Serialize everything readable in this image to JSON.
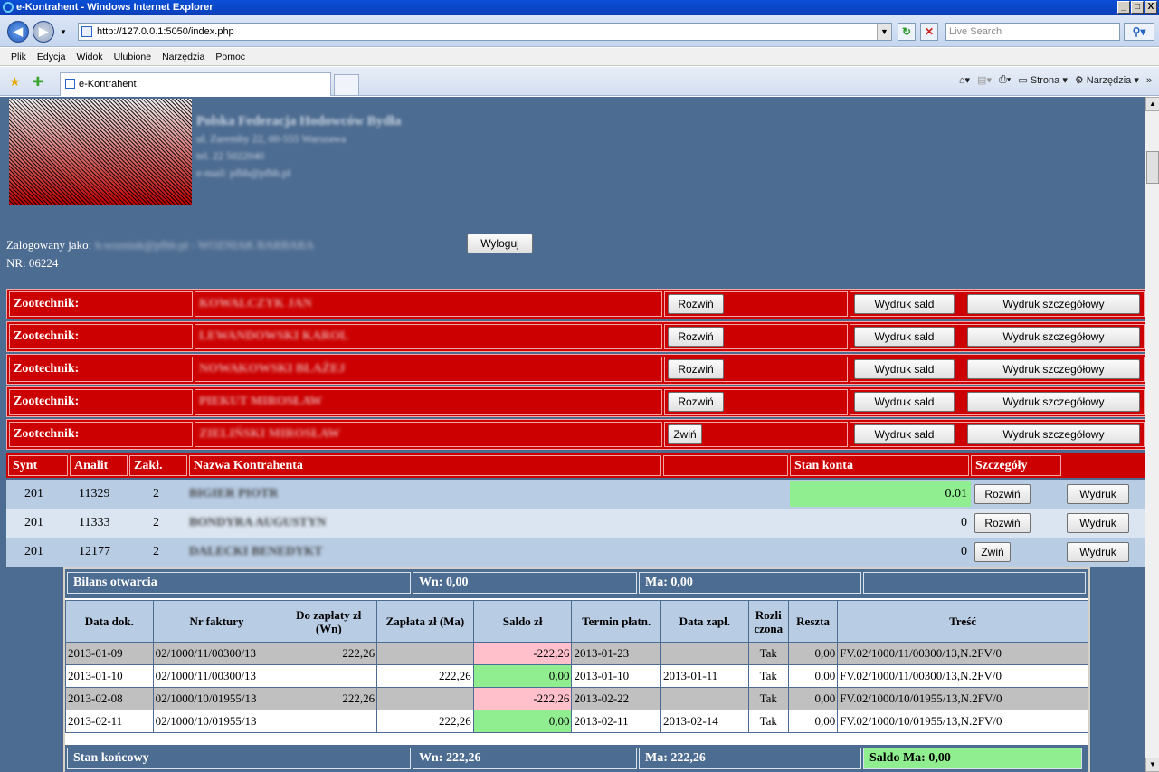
{
  "window": {
    "title": "e-Kontrahent - Windows Internet Explorer",
    "controls": [
      "_",
      "□",
      "X"
    ]
  },
  "address": {
    "url": "http://127.0.0.1:5050/index.php",
    "search_placeholder": "Live Search"
  },
  "menu": [
    "Plik",
    "Edycja",
    "Widok",
    "Ulubione",
    "Narzędzia",
    "Pomoc"
  ],
  "tab": {
    "label": "e-Kontrahent"
  },
  "commandbar": {
    "page": "Strona",
    "tools": "Narzędzia"
  },
  "header": {
    "org_name": "Polska Federacja Hodowców Bydła",
    "org_addr": "ul. Zaremby 22, 00-555 Warszawa",
    "org_tel": "tel. 22 5022040",
    "org_mail": "e-mail: pfhb@pfhb.pl",
    "logged_label": "Zalogowany jako:",
    "logged_user": "b.wozniak@pfhb.pl - WOZNIAK BARBARA",
    "logout": "Wyloguj",
    "nr": "NR: 06224"
  },
  "zoo": {
    "label": "Zootechnik:",
    "expand": "Rozwiń",
    "collapse": "Zwiń",
    "print_saldo": "Wydruk sald",
    "print_detail": "Wydruk szczegółowy",
    "rows": [
      {
        "name": "KOWALCZYK JAN",
        "btn": "Rozwiń"
      },
      {
        "name": "LEWANDOWSKI KAROL",
        "btn": "Rozwiń"
      },
      {
        "name": "NOWAKOWSKI BLAŻEJ",
        "btn": "Rozwiń"
      },
      {
        "name": "PIEKUT MIROSŁAW",
        "btn": "Rozwiń"
      },
      {
        "name": "ZIELIŃSKI MIROSŁAW",
        "btn": "Zwiń"
      }
    ]
  },
  "contractors": {
    "headers": {
      "synt": "Synt",
      "analit": "Analit",
      "zakl": "Zakł.",
      "name": "Nazwa Kontrahenta",
      "empty": "",
      "stan": "Stan konta",
      "det": "Szczegóły"
    },
    "print": "Wydruk",
    "rows": [
      {
        "synt": "201",
        "analit": "11329",
        "zakl": "2",
        "name": "BIGIER PIOTR",
        "stan": "0.01",
        "btn": "Rozwiń"
      },
      {
        "synt": "201",
        "analit": "11333",
        "zakl": "2",
        "name": "BONDYRA AUGUSTYN",
        "stan": "0",
        "btn": "Rozwiń"
      },
      {
        "synt": "201",
        "analit": "12177",
        "zakl": "2",
        "name": "DALECKI BENEDYKT",
        "stan": "0",
        "btn": "Zwiń"
      }
    ]
  },
  "details": {
    "open": {
      "label": "Bilans otwarcia",
      "wn": "Wn: 0,00",
      "ma": "Ma: 0,00",
      "saldo": ""
    },
    "close": {
      "label": "Stan końcowy",
      "wn": "Wn: 222,26",
      "ma": "Ma: 222,26",
      "saldo": "Saldo Ma: 0,00"
    },
    "columns": [
      "Data dok.",
      "Nr faktury",
      "Do zapłaty zł (Wn)",
      "Zapłata zł (Ma)",
      "Saldo zł",
      "Termin płatn.",
      "Data zapł.",
      "Rozli czona",
      "Reszta",
      "Treść"
    ],
    "rows": [
      [
        "2013-01-09",
        "02/1000/11/00300/13",
        "222,26",
        "",
        "-222,26",
        "2013-01-23",
        "",
        "Tak",
        "0,00",
        "FV.02/1000/11/00300/13,N.2FV/0"
      ],
      [
        "2013-01-10",
        "02/1000/11/00300/13",
        "",
        "222,26",
        "0,00",
        "2013-01-10",
        "2013-01-11",
        "Tak",
        "0,00",
        "FV.02/1000/11/00300/13,N.2FV/0"
      ],
      [
        "2013-02-08",
        "02/1000/10/01955/13",
        "222,26",
        "",
        "-222,26",
        "2013-02-22",
        "",
        "Tak",
        "0,00",
        "FV.02/1000/10/01955/13,N.2FV/0"
      ],
      [
        "2013-02-11",
        "02/1000/10/01955/13",
        "",
        "222,26",
        "0,00",
        "2013-02-11",
        "2013-02-14",
        "Tak",
        "0,00",
        "FV.02/1000/10/01955/13,N.2FV/0"
      ]
    ]
  },
  "colors": {
    "red": "#cc0000",
    "steel": "#4d6c91",
    "pink": "#ffc0cb",
    "green": "#90ee90"
  }
}
